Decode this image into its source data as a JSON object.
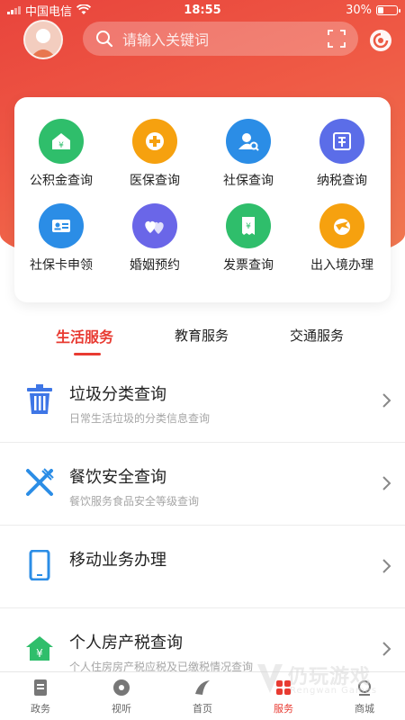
{
  "status_bar": {
    "carrier": "中国电信",
    "time": "18:55",
    "battery": "30%",
    "battery_level": 0.3
  },
  "header": {
    "search_placeholder": "请输入关键词"
  },
  "services": [
    {
      "label": "公积金查询",
      "icon": "house-yen-icon",
      "color": "#2fbe6b"
    },
    {
      "label": "医保查询",
      "icon": "medical-cross-icon",
      "color": "#f6a10f"
    },
    {
      "label": "社保查询",
      "icon": "person-search-icon",
      "color": "#2b8de6"
    },
    {
      "label": "纳税查询",
      "icon": "tax-icon",
      "color": "#5b6de8"
    },
    {
      "label": "社保卡申领",
      "icon": "id-card-icon",
      "color": "#2b8de6"
    },
    {
      "label": "婚姻预约",
      "icon": "hearts-icon",
      "color": "#6a66e8"
    },
    {
      "label": "发票查询",
      "icon": "invoice-icon",
      "color": "#2fbe6b"
    },
    {
      "label": "出入境办理",
      "icon": "globe-plane-icon",
      "color": "#f6a10f"
    }
  ],
  "tabs": [
    "生活服务",
    "教育服务",
    "交通服务"
  ],
  "active_tab": "生活服务",
  "list": [
    {
      "title": "垃圾分类查询",
      "subtitle": "日常生活垃圾的分类信息查询",
      "icon": "trash-icon"
    },
    {
      "title": "餐饮安全查询",
      "subtitle": "餐饮服务食品安全等级查询",
      "icon": "fork-knife-icon"
    },
    {
      "title": "移动业务办理",
      "subtitle": "",
      "icon": "mobile-phone-icon"
    },
    {
      "title": "个人房产税查询",
      "subtitle": "个人住房房产税应税及已缴税情况查询",
      "icon": "house-yen-icon"
    }
  ],
  "bottom_nav": [
    {
      "label": "政务",
      "icon": "document-icon"
    },
    {
      "label": "视听",
      "icon": "disc-icon"
    },
    {
      "label": "首页",
      "icon": "home-logo-icon"
    },
    {
      "label": "服务",
      "icon": "grid-icon"
    },
    {
      "label": "商城",
      "icon": "shop-icon"
    }
  ],
  "active_nav": "服务",
  "watermark": {
    "text": "仍玩游戏",
    "sub": "Rengwan Games"
  },
  "colors": {
    "accent": "#e83b32",
    "hero_start": "#e8443c",
    "hero_end": "#f07a52"
  }
}
